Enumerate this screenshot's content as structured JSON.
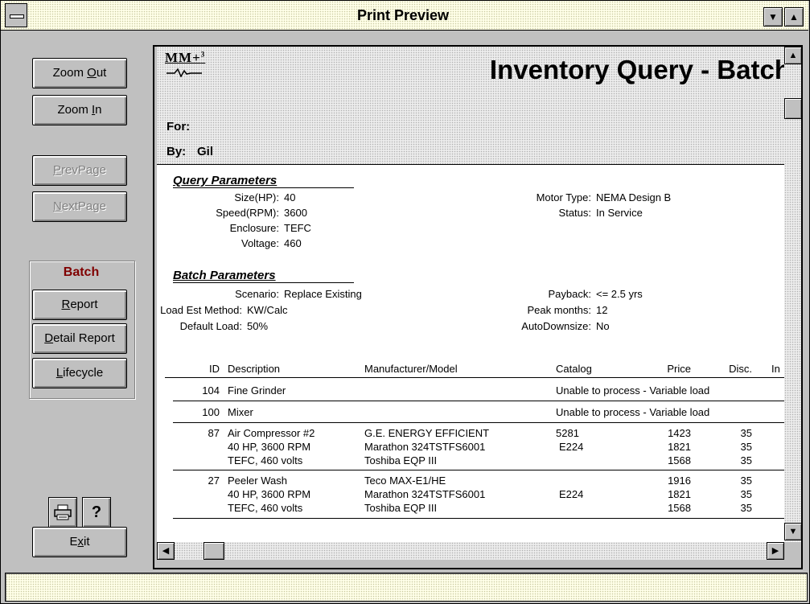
{
  "window": {
    "title": "Print Preview",
    "minimize_glyph": "▼",
    "maximize_glyph": "▲"
  },
  "toolbar": {
    "zoom_out": {
      "pre": "Zoom ",
      "key": "O",
      "post": "ut"
    },
    "zoom_in": {
      "pre": "Zoom ",
      "key": "I",
      "post": "n"
    },
    "prev_page": {
      "pre": "",
      "key": "P",
      "post": "revPage"
    },
    "next_page": {
      "pre": "",
      "key": "N",
      "post": "extPage"
    },
    "batch_label": "Batch",
    "report": {
      "pre": "",
      "key": "R",
      "post": "eport"
    },
    "detail_report": {
      "pre": "",
      "key": "D",
      "post": "etail Report"
    },
    "lifecycle": {
      "pre": "",
      "key": "L",
      "post": "ifecycle"
    },
    "print_icon": "printer-icon",
    "help_glyph": "?",
    "exit": {
      "pre": "E",
      "key": "x",
      "post": "it"
    }
  },
  "report": {
    "logo": "MM+",
    "logo_sup": "3",
    "title": "Inventory Query - Batch",
    "for_label": "For:",
    "for_value": "",
    "by_label": "By:",
    "by_value": "Gil",
    "query_params": {
      "heading": "Query Parameters",
      "left": [
        {
          "label": "Size(HP):",
          "value": "40"
        },
        {
          "label": "Speed(RPM):",
          "value": "3600"
        },
        {
          "label": "Enclosure:",
          "value": "TEFC"
        },
        {
          "label": "Voltage:",
          "value": "460"
        }
      ],
      "right": [
        {
          "label": "Motor Type:",
          "value": "NEMA Design B"
        },
        {
          "label": "Status:",
          "value": "In Service"
        }
      ]
    },
    "batch_params": {
      "heading": "Batch Parameters",
      "left": [
        {
          "label": "Scenario:",
          "value": "Replace Existing"
        },
        {
          "label": "Load Est Method:",
          "value": "KW/Calc"
        },
        {
          "label": "Default Load:",
          "value": "50%"
        }
      ],
      "right": [
        {
          "label": "Payback:",
          "value": "<= 2.5 yrs"
        },
        {
          "label": "Peak months:",
          "value": "12"
        },
        {
          "label": "AutoDownsize:",
          "value": "No"
        }
      ]
    },
    "columns": {
      "id": "ID",
      "description": "Description",
      "manufacturer": "Manufacturer/Model",
      "catalog": "Catalog",
      "price": "Price",
      "disc": "Disc.",
      "in": "In"
    },
    "rows": [
      {
        "id": "104",
        "description": "Fine Grinder",
        "note": "Unable to process - Variable load"
      },
      {
        "id": "100",
        "description": "Mixer",
        "note": "Unable to process - Variable load"
      },
      {
        "id": "87",
        "lines": [
          {
            "desc": "Air Compressor #2",
            "mfr": "G.E. ENERGY EFFICIENT",
            "catalog": "5281",
            "price": "1423",
            "disc": "35"
          },
          {
            "desc": "40 HP, 3600 RPM",
            "mfr": "Marathon 324TSTFS6001",
            "catalog": "E224",
            "price": "1821",
            "disc": "35"
          },
          {
            "desc": "TEFC, 460 volts",
            "mfr": "Toshiba EQP III",
            "catalog": "",
            "price": "1568",
            "disc": "35"
          }
        ]
      },
      {
        "id": "27",
        "lines": [
          {
            "desc": "Peeler Wash",
            "mfr": "Teco MAX-E1/HE",
            "catalog": "",
            "price": "1916",
            "disc": "35"
          },
          {
            "desc": "40 HP, 3600 RPM",
            "mfr": "Marathon 324TSTFS6001",
            "catalog": "E224",
            "price": "1821",
            "disc": "35"
          },
          {
            "desc": "TEFC, 460 volts",
            "mfr": "Toshiba EQP III",
            "catalog": "",
            "price": "1568",
            "disc": "35"
          }
        ]
      }
    ]
  },
  "scrollbars": {
    "up": "▲",
    "down": "▼",
    "left": "◀",
    "right": "▶"
  },
  "status": {
    "text": ""
  },
  "colors": {
    "batch_label": "#800000",
    "face": "#c0c0c0",
    "title_dither": "#ffffe8"
  }
}
